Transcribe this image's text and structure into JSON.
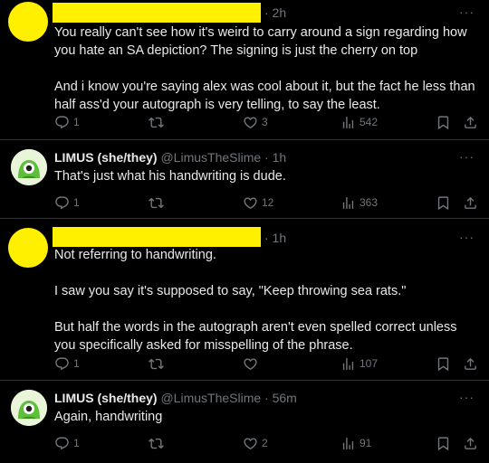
{
  "tweets": [
    {
      "time": "· 2h",
      "more": "···",
      "body": [
        "You really can't see how it's weird to carry around a sign regarding how you hate an SA depiction? The signing is just the cherry on top",
        "And i know you're saying alex was cool about it, but the fact he less than half ass'd your autograph is very telling, to say the least."
      ],
      "replies": "1",
      "retweets": "",
      "likes": "3",
      "views": "542"
    },
    {
      "name": "LIMUS (she/they)",
      "handle": "@LimusTheSlime",
      "time": "· 1h",
      "more": "···",
      "body": [
        "That's just what his handwriting is dude."
      ],
      "replies": "1",
      "retweets": "",
      "likes": "12",
      "views": "363"
    },
    {
      "time": "· 1h",
      "more": "···",
      "body": [
        "Not referring to handwriting.",
        "I saw you say it's supposed to say, \"Keep throwing sea rats.\"",
        "But half the words in the autograph aren't even spelled correct unless you specifically asked for misspelling of the phrase."
      ],
      "replies": "1",
      "retweets": "",
      "likes": "",
      "views": "107"
    },
    {
      "name": "LIMUS (she/they)",
      "handle": "@LimusTheSlime",
      "time": "· 56m",
      "more": "···",
      "body": [
        "Again, handwriting"
      ],
      "replies": "1",
      "retweets": "",
      "likes": "2",
      "views": "91"
    }
  ],
  "colors": {
    "redaction": "#fff000",
    "muted": "#71767b",
    "text": "#e7e9ea",
    "background": "#000000"
  },
  "icons": [
    "reply-icon",
    "retweet-icon",
    "like-icon",
    "views-icon",
    "bookmark-icon",
    "share-icon"
  ]
}
